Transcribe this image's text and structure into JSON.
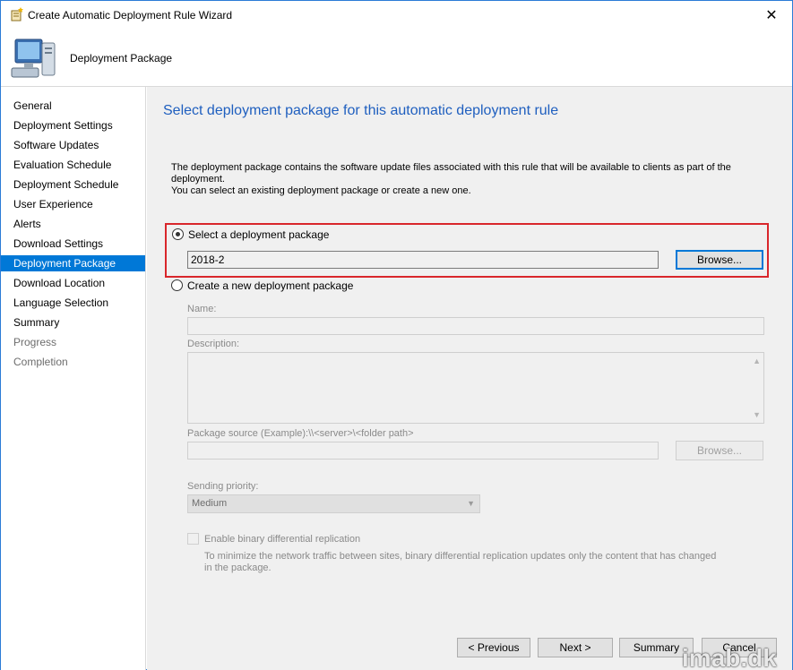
{
  "window": {
    "title": "Create Automatic Deployment Rule Wizard",
    "close_glyph": "✕"
  },
  "header": {
    "title": "Deployment Package",
    "icon": "computer-icon"
  },
  "sidebar": {
    "items": [
      {
        "label": "General",
        "state": "normal"
      },
      {
        "label": "Deployment Settings",
        "state": "normal"
      },
      {
        "label": "Software Updates",
        "state": "normal"
      },
      {
        "label": "Evaluation Schedule",
        "state": "normal"
      },
      {
        "label": "Deployment Schedule",
        "state": "normal"
      },
      {
        "label": "User Experience",
        "state": "normal"
      },
      {
        "label": "Alerts",
        "state": "normal"
      },
      {
        "label": "Download Settings",
        "state": "normal"
      },
      {
        "label": "Deployment Package",
        "state": "active"
      },
      {
        "label": "Download Location",
        "state": "normal"
      },
      {
        "label": "Language Selection",
        "state": "normal"
      },
      {
        "label": "Summary",
        "state": "normal"
      },
      {
        "label": "Progress",
        "state": "disabled"
      },
      {
        "label": "Completion",
        "state": "disabled"
      }
    ]
  },
  "main": {
    "title": "Select deployment package for this automatic deployment rule",
    "description_line1": "The deployment package contains the software update files associated with this rule that will be available to clients as part of the deployment.",
    "description_line2": "You can select an existing deployment package or create a new one.",
    "select_existing": {
      "label": "Select a deployment package",
      "checked": true,
      "value": "2018-2",
      "browse_label": "Browse..."
    },
    "create_new": {
      "label": "Create a new deployment package",
      "checked": false,
      "name_label": "Name:",
      "name_value": "",
      "description_label": "Description:",
      "description_value": "",
      "source_label": "Package source (Example):\\\\<server>\\<folder path>",
      "source_value": "",
      "browse_label": "Browse...",
      "priority_label": "Sending priority:",
      "priority_value": "Medium",
      "binary_label": "Enable binary differential replication",
      "binary_checked": false,
      "binary_help_line1": "To minimize the network traffic between sites, binary differential replication updates only the content that has changed",
      "binary_help_line2": "in the package."
    }
  },
  "footer": {
    "previous_label": "< Previous",
    "next_label": "Next >",
    "summary_label": "Summary",
    "cancel_label": "Cancel"
  },
  "watermark": "imab.dk",
  "colors": {
    "accent": "#0078d7",
    "title_blue": "#1f5fbf",
    "highlight_red": "#d9262b"
  }
}
